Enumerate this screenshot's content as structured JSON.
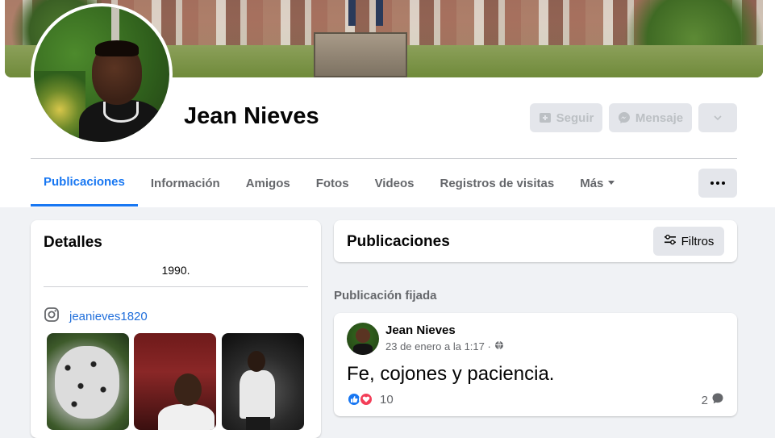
{
  "profile": {
    "name": "Jean Nieves"
  },
  "actions": {
    "follow_label": "Seguir",
    "message_label": "Mensaje"
  },
  "tabs": [
    {
      "label": "Publicaciones",
      "active": true
    },
    {
      "label": "Información"
    },
    {
      "label": "Amigos"
    },
    {
      "label": "Fotos"
    },
    {
      "label": "Videos"
    },
    {
      "label": "Registros de visitas"
    },
    {
      "label": "Más"
    }
  ],
  "details": {
    "title": "Detalles",
    "year": "1990.",
    "instagram": "jeanieves1820"
  },
  "posts": {
    "title": "Publicaciones",
    "filters_label": "Filtros",
    "pinned_label": "Publicación fijada",
    "items": [
      {
        "author": "Jean Nieves",
        "timestamp": "23 de enero a la 1:17 ·",
        "text": "Fe, cojones y paciencia.",
        "reaction_count": "10",
        "comment_count": "2"
      }
    ]
  },
  "colors": {
    "accent": "#1877f2",
    "love": "#f33e58",
    "secondary_text": "#65676b",
    "background": "#f0f2f5"
  },
  "icons": {
    "follow": "add-follow-icon",
    "message": "messenger-icon",
    "more": "chevron-down-icon",
    "options": "more-dots-icon",
    "filters": "sliders-icon",
    "instagram": "instagram-icon",
    "privacy": "globe-icon",
    "like": "like-icon",
    "love": "love-icon",
    "comment": "comment-icon"
  }
}
